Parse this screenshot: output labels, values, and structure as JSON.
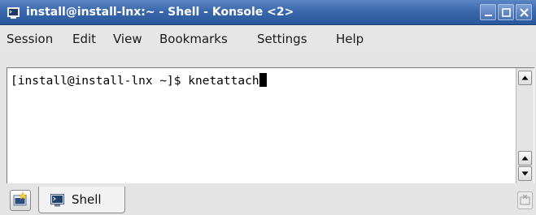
{
  "window": {
    "title": "install@install-lnx:~ - Shell - Konsole <2>",
    "colors": {
      "titlebar": "#3b68ad",
      "terminal_bg": "#ffffff",
      "terminal_fg": "#000000"
    }
  },
  "menubar": {
    "items": [
      "Session",
      "Edit",
      "View",
      "Bookmarks",
      "Settings",
      "Help"
    ]
  },
  "terminal": {
    "prompt": "[install@install-lnx ~]$ ",
    "command": "knetattach"
  },
  "tabs": [
    {
      "label": "Shell",
      "icon": "terminal-icon",
      "active": true
    }
  ],
  "icons": {
    "app": "konsole-terminal-icon",
    "new_tab": "new-tab-icon",
    "close_tab": "close-tab-icon"
  }
}
